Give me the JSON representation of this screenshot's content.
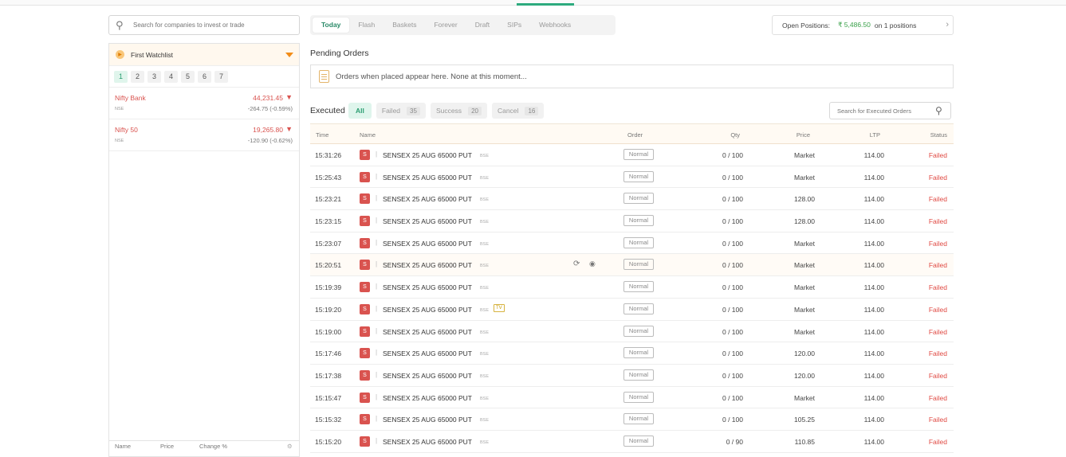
{
  "search": {
    "placeholder": "Search for companies to invest or trade"
  },
  "watchlist": {
    "title": "First Watchlist",
    "tabs": [
      "1",
      "2",
      "3",
      "4",
      "5",
      "6",
      "7"
    ],
    "items": [
      {
        "name": "Nifty Bank",
        "exchange": "NSE",
        "price": "44,231.45",
        "change": "-264.75 (-0.59%)"
      },
      {
        "name": "Nifty 50",
        "exchange": "NSE",
        "price": "19,265.80",
        "change": "-120.90 (-0.62%)"
      }
    ],
    "footer": {
      "name": "Name",
      "price": "Price",
      "change": "Change %"
    }
  },
  "tabs": [
    "Today",
    "Flash",
    "Baskets",
    "Forever",
    "Draft",
    "SIPs",
    "Webhooks"
  ],
  "open_positions": {
    "label": "Open Positions:",
    "amount": "₹ 5,486.50",
    "count": "on 1 positions"
  },
  "pending": {
    "title": "Pending Orders",
    "message": "Orders when placed appear here. None at this moment..."
  },
  "executed": {
    "title": "Executed",
    "filters": {
      "all": "All",
      "failed": "Failed",
      "failed_count": "35",
      "success": "Success",
      "success_count": "20",
      "cancel": "Cancel",
      "cancel_count": "16"
    },
    "search_placeholder": "Search for Executed Orders",
    "columns": {
      "time": "Time",
      "name": "Name",
      "order": "Order",
      "qty": "Qty",
      "price": "Price",
      "ltp": "LTP",
      "status": "Status"
    },
    "rows": [
      {
        "time": "15:31:26",
        "badge": "S",
        "name": "SENSEX 25 AUG 65000 PUT",
        "exchange": "BSE",
        "order": "Normal",
        "qty": "0 / 100",
        "price": "Market",
        "ltp": "114.00",
        "status": "Failed"
      },
      {
        "time": "15:25:43",
        "badge": "S",
        "name": "SENSEX 25 AUG 65000 PUT",
        "exchange": "BSE",
        "order": "Normal",
        "qty": "0 / 100",
        "price": "Market",
        "ltp": "114.00",
        "status": "Failed"
      },
      {
        "time": "15:23:21",
        "badge": "S",
        "name": "SENSEX 25 AUG 65000 PUT",
        "exchange": "BSE",
        "order": "Normal",
        "qty": "0 / 100",
        "price": "128.00",
        "ltp": "114.00",
        "status": "Failed"
      },
      {
        "time": "15:23:15",
        "badge": "S",
        "name": "SENSEX 25 AUG 65000 PUT",
        "exchange": "BSE",
        "order": "Normal",
        "qty": "0 / 100",
        "price": "128.00",
        "ltp": "114.00",
        "status": "Failed"
      },
      {
        "time": "15:23:07",
        "badge": "S",
        "name": "SENSEX 25 AUG 65000 PUT",
        "exchange": "BSE",
        "order": "Normal",
        "qty": "0 / 100",
        "price": "Market",
        "ltp": "114.00",
        "status": "Failed"
      },
      {
        "time": "15:20:51",
        "badge": "S",
        "name": "SENSEX 25 AUG 65000 PUT",
        "exchange": "BSE",
        "order": "Normal",
        "qty": "0 / 100",
        "price": "Market",
        "ltp": "114.00",
        "status": "Failed",
        "highlight": true
      },
      {
        "time": "15:19:39",
        "badge": "S",
        "name": "SENSEX 25 AUG 65000 PUT",
        "exchange": "BSE",
        "order": "Normal",
        "qty": "0 / 100",
        "price": "Market",
        "ltp": "114.00",
        "status": "Failed"
      },
      {
        "time": "15:19:20",
        "badge": "S",
        "name": "SENSEX 25 AUG 65000 PUT",
        "exchange": "BSE",
        "order": "Normal",
        "qty": "0 / 100",
        "price": "Market",
        "ltp": "114.00",
        "status": "Failed",
        "tag": "TV"
      },
      {
        "time": "15:19:00",
        "badge": "S",
        "name": "SENSEX 25 AUG 65000 PUT",
        "exchange": "BSE",
        "order": "Normal",
        "qty": "0 / 100",
        "price": "Market",
        "ltp": "114.00",
        "status": "Failed"
      },
      {
        "time": "15:17:46",
        "badge": "S",
        "name": "SENSEX 25 AUG 65000 PUT",
        "exchange": "BSE",
        "order": "Normal",
        "qty": "0 / 100",
        "price": "120.00",
        "ltp": "114.00",
        "status": "Failed"
      },
      {
        "time": "15:17:38",
        "badge": "S",
        "name": "SENSEX 25 AUG 65000 PUT",
        "exchange": "BSE",
        "order": "Normal",
        "qty": "0 / 100",
        "price": "120.00",
        "ltp": "114.00",
        "status": "Failed"
      },
      {
        "time": "15:15:47",
        "badge": "S",
        "name": "SENSEX 25 AUG 65000 PUT",
        "exchange": "BSE",
        "order": "Normal",
        "qty": "0 / 100",
        "price": "Market",
        "ltp": "114.00",
        "status": "Failed"
      },
      {
        "time": "15:15:32",
        "badge": "S",
        "name": "SENSEX 25 AUG 65000 PUT",
        "exchange": "BSE",
        "order": "Normal",
        "qty": "0 / 100",
        "price": "105.25",
        "ltp": "114.00",
        "status": "Failed"
      },
      {
        "time": "15:15:20",
        "badge": "S",
        "name": "SENSEX 25 AUG 65000 PUT",
        "exchange": "BSE",
        "order": "Normal",
        "qty": "0 / 90",
        "price": "110.85",
        "ltp": "114.00",
        "status": "Failed"
      }
    ]
  },
  "colors": {
    "accent": "#2daa7e",
    "loss": "#d9534f",
    "profit": "#3aa14a",
    "watchlist_caret": "#f28c18"
  }
}
